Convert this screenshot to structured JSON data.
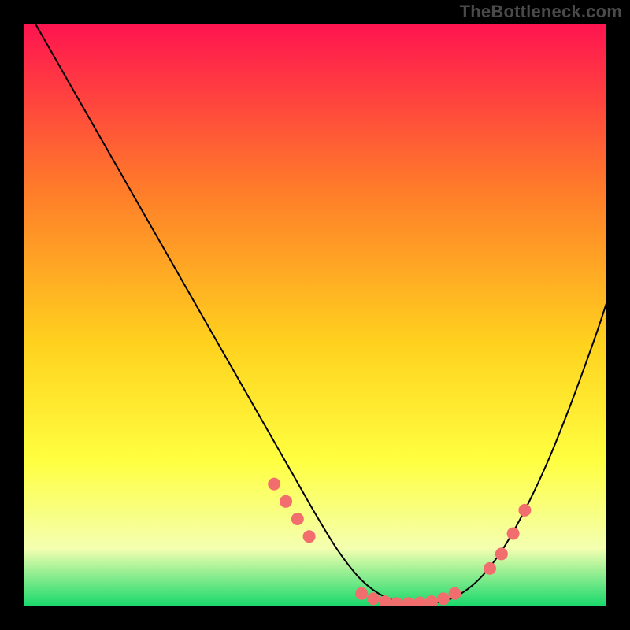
{
  "watermark": "TheBottleneck.com",
  "chart_data": {
    "type": "line",
    "title": "",
    "xlabel": "",
    "ylabel": "",
    "xlim": [
      0,
      100
    ],
    "ylim": [
      0,
      100
    ],
    "series": [
      {
        "name": "curve",
        "x": [
          2,
          6,
          10,
          14,
          18,
          22,
          26,
          30,
          34,
          38,
          42,
          46,
          50,
          54,
          58,
          62,
          66,
          70,
          74,
          78,
          82,
          86,
          90,
          94,
          98,
          100
        ],
        "y": [
          100,
          93,
          86,
          79,
          72,
          65,
          58,
          51,
          44,
          37,
          30,
          23,
          16,
          9.5,
          4.5,
          1.6,
          0.5,
          0.5,
          1.6,
          4.5,
          9.5,
          16.5,
          25,
          35,
          46,
          52
        ]
      },
      {
        "name": "dots",
        "x": [
          43,
          45,
          47,
          49,
          58,
          60,
          62,
          64,
          66,
          68,
          70,
          72,
          74,
          80,
          82,
          84,
          86
        ],
        "y": [
          21,
          18,
          15,
          12,
          2.2,
          1.3,
          0.8,
          0.5,
          0.5,
          0.6,
          0.8,
          1.3,
          2.2,
          6.5,
          9.0,
          12.5,
          16.5
        ]
      }
    ],
    "gradient": {
      "top": "#ff1450",
      "mid1": "#ff7a2a",
      "mid2": "#ffd21e",
      "mid3": "#ffff40",
      "mid4": "#f4ffb0",
      "bottom": "#17d86b"
    },
    "dot_color": "#f26e6e",
    "dot_radius": 8
  }
}
